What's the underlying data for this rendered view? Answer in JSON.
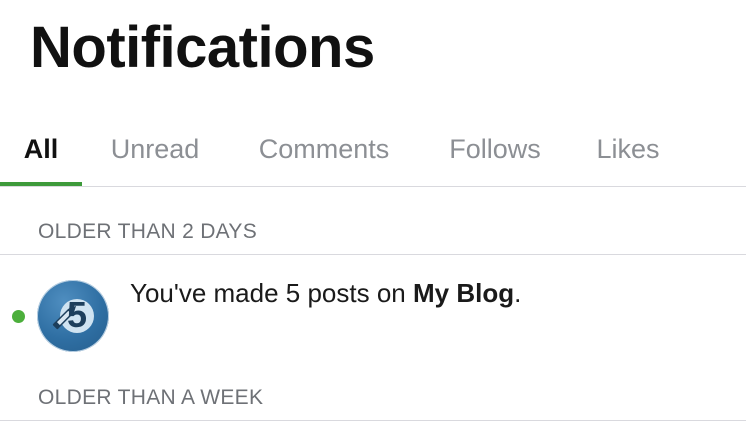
{
  "header": {
    "title": "Notifications"
  },
  "tabs": [
    {
      "label": "All",
      "active": true
    },
    {
      "label": "Unread",
      "active": false
    },
    {
      "label": "Comments",
      "active": false
    },
    {
      "label": "Follows",
      "active": false
    },
    {
      "label": "Likes",
      "active": false
    }
  ],
  "sections": [
    {
      "label": "OLDER THAN 2 DAYS",
      "items": [
        {
          "unread": true,
          "icon": "pencil-milestone-5-icon",
          "badge_number": "5",
          "text_prefix": "You've made 5 posts on ",
          "text_bold": "My Blog",
          "text_suffix": "."
        }
      ]
    },
    {
      "label": "OLDER THAN A WEEK",
      "items": []
    }
  ],
  "colors": {
    "accent": "#3d9a3a",
    "unread_dot": "#4caf3c",
    "avatar_blue": "#2f6fa3",
    "tab_inactive": "#8c8f94",
    "section_label": "#6e7176"
  }
}
